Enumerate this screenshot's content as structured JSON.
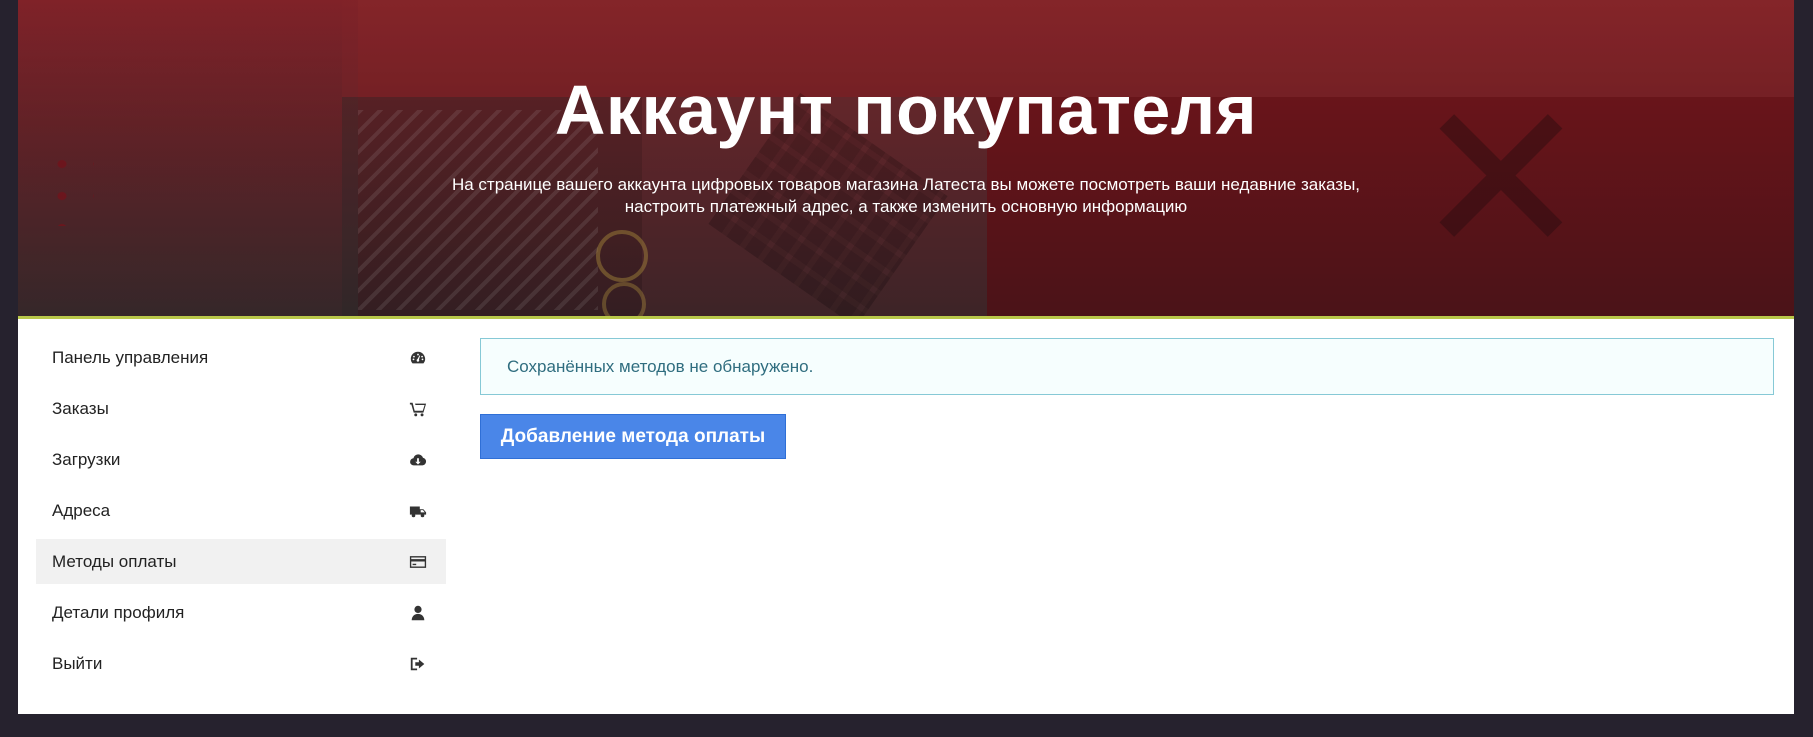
{
  "hero": {
    "title": "Аккаунт покупателя",
    "subtitle_line1": "На странице вашего аккаунта цифровых товаров магазина Латеста вы можете посмотреть ваши недавние заказы,",
    "subtitle_line2": "настроить платежный адрес, а также изменить основную информацию"
  },
  "sidebar": {
    "items": [
      {
        "label": "Панель управления",
        "icon": "dashboard-icon",
        "active": false
      },
      {
        "label": "Заказы",
        "icon": "cart-icon",
        "active": false
      },
      {
        "label": "Загрузки",
        "icon": "cloud-download-icon",
        "active": false
      },
      {
        "label": "Адреса",
        "icon": "truck-icon",
        "active": false
      },
      {
        "label": "Методы оплаты",
        "icon": "credit-card-icon",
        "active": true
      },
      {
        "label": "Детали профиля",
        "icon": "user-icon",
        "active": false
      },
      {
        "label": "Выйти",
        "icon": "sign-out-icon",
        "active": false
      }
    ]
  },
  "main": {
    "notice": "Сохранённых методов не обнаружено.",
    "add_button": "Добавление метода оплаты"
  },
  "colors": {
    "accent": "#4a86e8",
    "notice_border": "#86c9d6",
    "notice_text": "#2f6d7f",
    "hero_divider": "#b9c84a"
  }
}
